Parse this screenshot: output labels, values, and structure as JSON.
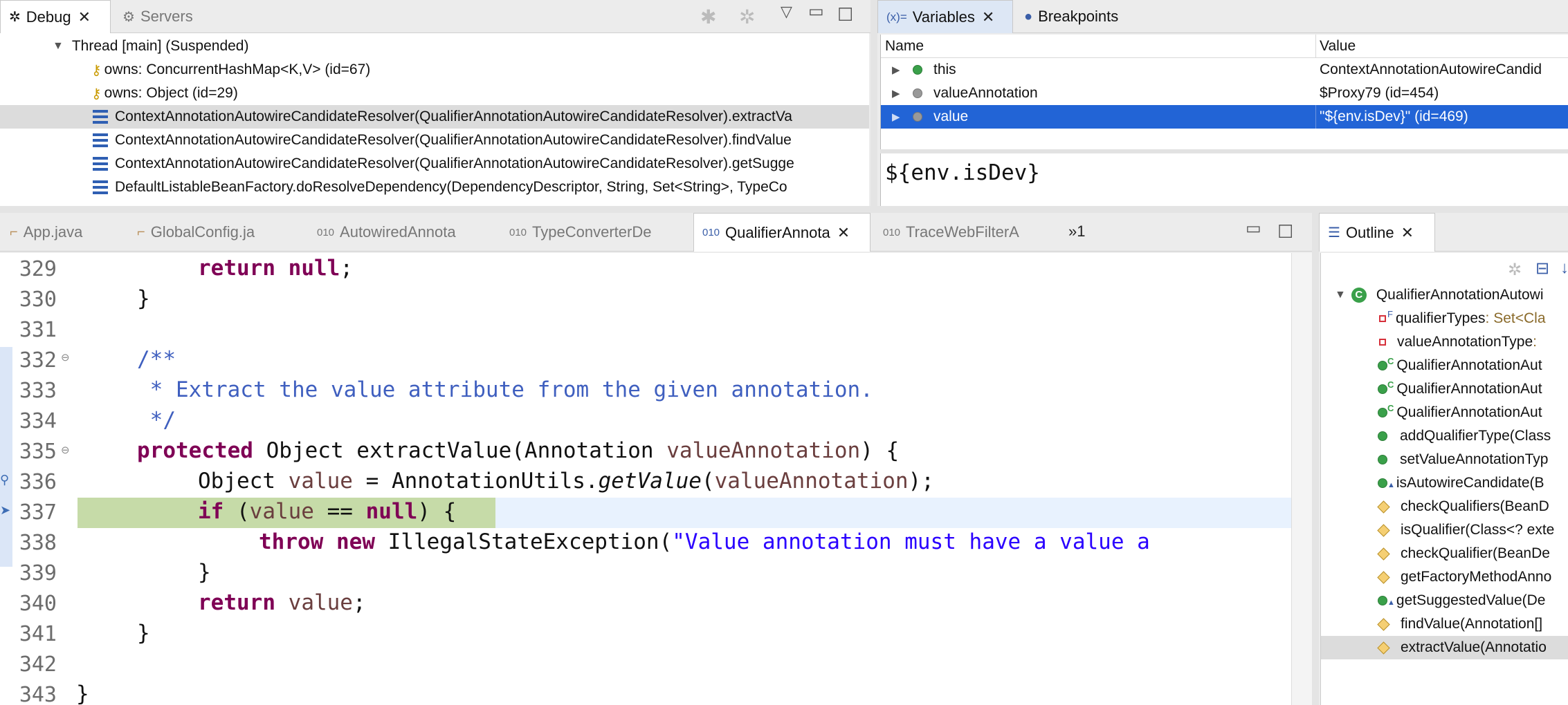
{
  "debug_view": {
    "tabs": [
      {
        "label": "Debug",
        "icon": "bug-icon",
        "active": true
      },
      {
        "label": "Servers",
        "icon": "servers-icon",
        "active": false
      }
    ],
    "thread": "Thread [main] (Suspended)",
    "owns": [
      "owns: ConcurrentHashMap<K,V>  (id=67)",
      "owns: Object  (id=29)"
    ],
    "frames": [
      "ContextAnnotationAutowireCandidateResolver(QualifierAnnotationAutowireCandidateResolver).extractVa",
      "ContextAnnotationAutowireCandidateResolver(QualifierAnnotationAutowireCandidateResolver).findValue",
      "ContextAnnotationAutowireCandidateResolver(QualifierAnnotationAutowireCandidateResolver).getSugge",
      "DefaultListableBeanFactory.doResolveDependency(DependencyDescriptor, String, Set<String>, TypeCo"
    ]
  },
  "variables_view": {
    "tabs": [
      {
        "label": "Variables",
        "prefix": "(x)=",
        "active": true
      },
      {
        "label": "Breakpoints",
        "active": false
      }
    ],
    "columns": {
      "name": "Name",
      "value": "Value"
    },
    "rows": [
      {
        "name": "this",
        "value": "ContextAnnotationAutowireCandid",
        "icon": "green-dot"
      },
      {
        "name": "valueAnnotation",
        "value": "$Proxy79  (id=454)",
        "icon": "local-var-icon"
      },
      {
        "name": "value",
        "value": "\"${env.isDev}\" (id=469)",
        "icon": "local-var-icon",
        "selected": true
      }
    ],
    "detail": "${env.isDev}"
  },
  "editor": {
    "tabs": [
      {
        "label": "App.java",
        "active": false
      },
      {
        "label": "GlobalConfig.ja",
        "active": false
      },
      {
        "label": "AutowiredAnnota",
        "active": false
      },
      {
        "label": "TypeConverterDe",
        "active": false
      },
      {
        "label": "QualifierAnnota",
        "active": true
      },
      {
        "label": "TraceWebFilterA",
        "active": false
      }
    ],
    "overflow": "»1",
    "line_numbers": [
      "329",
      "330",
      "331",
      "332",
      "333",
      "334",
      "335",
      "336",
      "337",
      "338",
      "339",
      "340",
      "341",
      "342",
      "343"
    ],
    "code": {
      "l329_kw": "return",
      "l329_kw2": "null",
      "l329_rest": ";",
      "l330": "}",
      "l332": "/**",
      "l333": " * Extract the value attribute from the given annotation.",
      "l334": " */",
      "l335_kw": "protected",
      "l335_a": " Object extractValue(Annotation ",
      "l335_f": "valueAnnotation",
      "l335_b": ") {",
      "l336_a": "Object ",
      "l336_f": "value",
      "l336_b": " = AnnotationUtils.",
      "l336_i": "getValue",
      "l336_c": "(",
      "l336_f2": "valueAnnotation",
      "l336_d": ");",
      "l337_kw": "if",
      "l337_a": " (",
      "l337_f": "value",
      "l337_b": " == ",
      "l337_kw2": "null",
      "l337_c": ") {",
      "l338_kw": "throw",
      "l338_kw2": "new",
      "l338_a": " IllegalStateException(",
      "l338_s": "\"Value annotation must have a value a",
      "l339": "}",
      "l340_kw": "return",
      "l340_f": "value",
      "l340_b": ";",
      "l341": "}",
      "l343": "}"
    }
  },
  "outline_view": {
    "tab": "Outline",
    "root": "QualifierAnnotationAutowi",
    "items": [
      {
        "label": "qualifierTypes",
        "type": " : Set<Cla",
        "icon": "private-field-icon",
        "badge": "F"
      },
      {
        "label": "valueAnnotationType",
        "type": " :",
        "icon": "private-field-icon",
        "badge": ""
      },
      {
        "label": "QualifierAnnotationAut",
        "type": "",
        "icon": "public-method-icon",
        "badge": "C"
      },
      {
        "label": "QualifierAnnotationAut",
        "type": "",
        "icon": "public-method-icon",
        "badge": "C"
      },
      {
        "label": "QualifierAnnotationAut",
        "type": "",
        "icon": "public-method-icon",
        "badge": "C"
      },
      {
        "label": "addQualifierType(Class",
        "type": "",
        "icon": "public-method-icon",
        "badge": ""
      },
      {
        "label": "setValueAnnotationTyp",
        "type": "",
        "icon": "public-method-icon",
        "badge": ""
      },
      {
        "label": "isAutowireCandidate(B",
        "type": "",
        "icon": "public-method-icon",
        "badge": "▲"
      },
      {
        "label": "checkQualifiers(BeanD",
        "type": "",
        "icon": "protected-method-icon",
        "badge": ""
      },
      {
        "label": "isQualifier(Class<? exte",
        "type": "",
        "icon": "protected-method-icon",
        "badge": ""
      },
      {
        "label": "checkQualifier(BeanDe",
        "type": "",
        "icon": "protected-method-icon",
        "badge": ""
      },
      {
        "label": "getFactoryMethodAnno",
        "type": "",
        "icon": "protected-method-icon",
        "badge": ""
      },
      {
        "label": "getSuggestedValue(De",
        "type": "",
        "icon": "public-method-icon",
        "badge": "▲"
      },
      {
        "label": "findValue(Annotation[]",
        "type": "",
        "icon": "protected-method-icon",
        "badge": ""
      },
      {
        "label": "extractValue(Annotatio",
        "type": "",
        "icon": "protected-method-icon",
        "badge": "",
        "selected": true
      }
    ]
  }
}
